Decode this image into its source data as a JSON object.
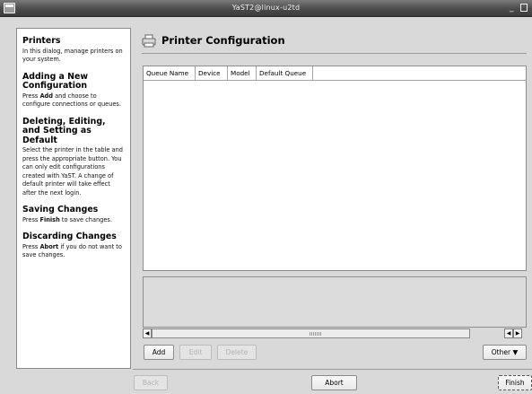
{
  "window": {
    "title": "YaST2@linux-u2td"
  },
  "help": {
    "sections": [
      {
        "title": "Printers",
        "body": "In this dialog, manage printers on your system."
      },
      {
        "title": "Adding a New Configuration",
        "body_pre": "Press ",
        "body_bold": "Add",
        "body_post": " and choose to configure connections or queues."
      },
      {
        "title": "Deleting, Editing, and Setting as Default",
        "body": "Select the printer in the table and press the appropriate button. You can only edit configurations created with YaST. A change of default printer will take effect after the next login."
      },
      {
        "title": "Saving Changes",
        "body_pre": "Press ",
        "body_bold": "Finish",
        "body_post": " to save changes."
      },
      {
        "title": "Discarding Changes",
        "body_pre": "Press ",
        "body_bold": "Abort",
        "body_post": " if you do not want to save changes."
      }
    ]
  },
  "main": {
    "title": "Printer Configuration",
    "columns": [
      "Queue Name",
      "Device",
      "Model",
      "Default Queue"
    ]
  },
  "buttons": {
    "add": "Add",
    "edit": "Edit",
    "delete": "Delete",
    "other": "Other",
    "back": "Back",
    "abort": "Abort",
    "finish": "Finish"
  },
  "icons": {
    "printer": "printer-icon",
    "window_menu": "window-menu-icon",
    "minimize": "minimize-icon",
    "maximize": "maximize-icon",
    "dropdown": "chevron-down-icon"
  }
}
